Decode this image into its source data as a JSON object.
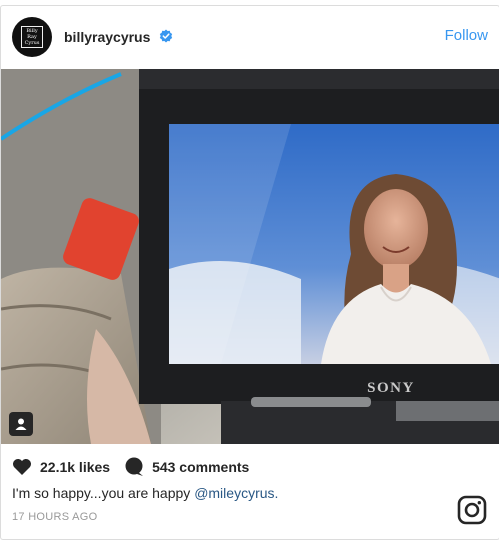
{
  "header": {
    "username": "billyraycyrus",
    "follow_label": "Follow",
    "avatar_text": "Billy Ray Cyrus",
    "verified_icon": "verified-badge-icon"
  },
  "photo": {
    "camera_brand": "SONY",
    "user_tag_icon": "user-tag-icon"
  },
  "stats": {
    "likes": "22.1k likes",
    "comments": "543 comments"
  },
  "caption": {
    "text": "I'm so happy...you are happy ",
    "mention": "@mileycyrus."
  },
  "timestamp": "17 HOURS AGO",
  "colors": {
    "accent": "#3897f0",
    "verified": "#3897f0",
    "mention": "#2a5885"
  }
}
